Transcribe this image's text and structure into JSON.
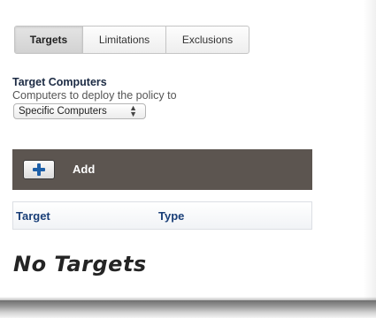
{
  "tabs": [
    {
      "label": "Targets",
      "active": true
    },
    {
      "label": "Limitations",
      "active": false
    },
    {
      "label": "Exclusions",
      "active": false
    }
  ],
  "section": {
    "title": "Target Computers",
    "description": "Computers to deploy the policy to"
  },
  "target_select": {
    "selected": "Specific Computers"
  },
  "add_bar": {
    "add_label": "Add",
    "add_icon": "plus-icon",
    "bar_color": "#5c5550",
    "icon_color": "#1d5fa8"
  },
  "table": {
    "columns": [
      "Target",
      "Type"
    ],
    "header_color": "#1a3f78"
  },
  "empty_message": "No Targets"
}
